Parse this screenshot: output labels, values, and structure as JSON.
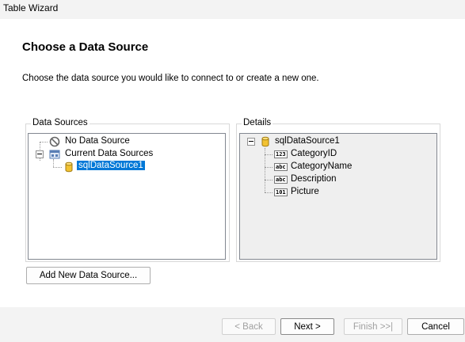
{
  "window": {
    "title": "Table Wizard"
  },
  "header": {
    "title": "Choose a Data Source",
    "description": "Choose the data source you would like to connect to or create a new one."
  },
  "data_sources": {
    "legend": "Data Sources",
    "items": [
      {
        "label": "No Data Source",
        "icon": "no-symbol-icon"
      },
      {
        "label": "Current Data Sources",
        "icon": "data-sources-icon"
      },
      {
        "label": "sqlDataSource1",
        "icon": "database-cylinder-icon",
        "selected": true
      }
    ]
  },
  "details": {
    "legend": "Details",
    "root": {
      "label": "sqlDataSource1",
      "icon": "database-cylinder-icon"
    },
    "fields": [
      {
        "label": "CategoryID",
        "icon": "numeric-field-icon",
        "glyph": "123"
      },
      {
        "label": "CategoryName",
        "icon": "text-field-icon",
        "glyph": "abc"
      },
      {
        "label": "Description",
        "icon": "text-field-icon",
        "glyph": "abc"
      },
      {
        "label": "Picture",
        "icon": "binary-field-icon",
        "glyph": "101"
      }
    ]
  },
  "buttons": {
    "add_new": "Add New Data Source...",
    "back": "< Back",
    "next": "Next >",
    "finish": "Finish >>|",
    "cancel": "Cancel"
  },
  "colors": {
    "selection": "#0078d7",
    "details_background": "#efefef",
    "footer_background": "#f3f3f3"
  }
}
